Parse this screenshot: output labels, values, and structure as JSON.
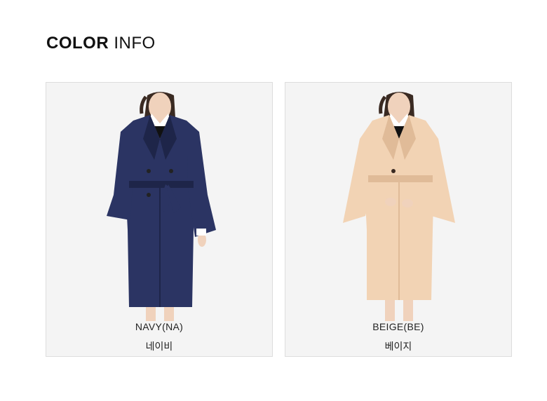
{
  "header": {
    "title_bold": "COLOR",
    "title_light": "INFO"
  },
  "colors": [
    {
      "code": "NAVY(NA)",
      "name_ko": "네이비",
      "coat_color": "#2b3463",
      "coat_shade": "#1e2549",
      "photo_icon": "model-wearing-coat"
    },
    {
      "code": "BEIGE(BE)",
      "name_ko": "베이지",
      "coat_color": "#f2d3b4",
      "coat_shade": "#e0bb98",
      "photo_icon": "model-wearing-coat"
    }
  ]
}
